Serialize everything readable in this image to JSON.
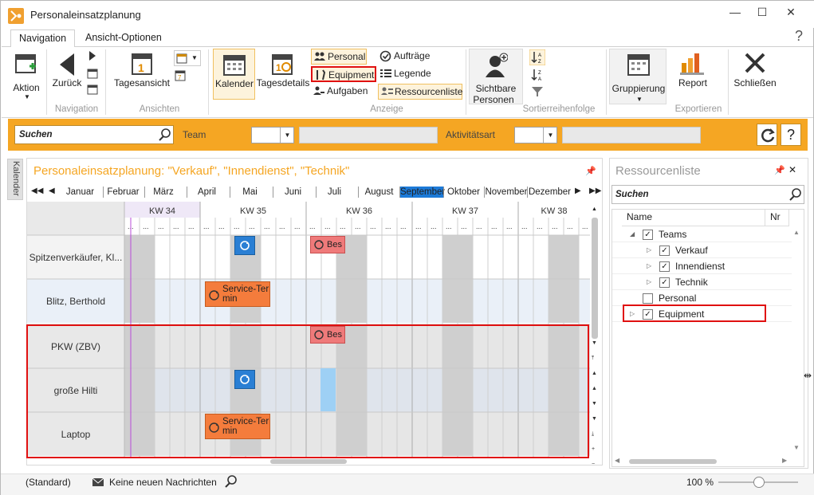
{
  "window": {
    "title": "Personaleinsatzplanung",
    "minimize": "—",
    "maximize": "☐",
    "close": "✕",
    "help": "?"
  },
  "tabs": [
    {
      "label": "Navigation"
    },
    {
      "label": "Ansicht-Optionen"
    }
  ],
  "ribbon": {
    "aktion": "Aktion",
    "zurueck": "Zurück",
    "tagesansicht": "Tagesansicht",
    "kalender": "Kalender",
    "tagesdetails": "Tagesdetails",
    "personal": "Personal",
    "equipment": "Equipment",
    "aufgaben": "Aufgaben",
    "auftraege": "Aufträge",
    "legende": "Legende",
    "ressourcenliste": "Ressourcenliste",
    "sichtbare_personen": "Sichtbare",
    "sichtbare_personen2": "Personen",
    "gruppierung": "Gruppierung",
    "report": "Report",
    "schliessen": "Schließen",
    "groups": {
      "navigation": "Navigation",
      "ansichten": "Ansichten",
      "anzeige": "Anzeige",
      "sortier": "Sortierreihenfolge",
      "exportieren": "Exportieren"
    }
  },
  "filter": {
    "search_placeholder": "Suchen",
    "team_label": "Team",
    "activity_label": "Aktivitätsart"
  },
  "sidebar_tab": "Kalender",
  "calendar": {
    "title": "Personaleinsatzplanung: \"Verkauf\", \"Innendienst\", \"Technik\"",
    "months": [
      "Januar",
      "Februar",
      "März",
      "April",
      "Mai",
      "Juni",
      "Juli",
      "August",
      "September",
      "Oktober",
      "November",
      "Dezember"
    ],
    "selected_month": "September",
    "weeks": [
      "KW 34",
      "KW 35",
      "KW 36",
      "KW 37",
      "KW 38"
    ],
    "rows": [
      {
        "label": "Spitzenverkäufer, Kl..."
      },
      {
        "label": "Blitz, Berthold"
      },
      {
        "label": "PKW (ZBV)"
      },
      {
        "label": "große Hilti"
      },
      {
        "label": "Laptop"
      }
    ],
    "events": {
      "bes": "Bes",
      "service": "Service-Ter min"
    }
  },
  "resource_list": {
    "title": "Ressourcenliste",
    "search_placeholder": "Suchen",
    "col_name": "Name",
    "col_nr": "Nr",
    "items": [
      {
        "label": "Teams",
        "checked": true
      },
      {
        "label": "Verkauf",
        "checked": true
      },
      {
        "label": "Innendienst",
        "checked": true
      },
      {
        "label": "Technik",
        "checked": true
      },
      {
        "label": "Personal",
        "checked": false
      },
      {
        "label": "Equipment",
        "checked": true
      }
    ]
  },
  "status": {
    "profile": "(Standard)",
    "messages": "Keine neuen Nachrichten",
    "zoom": "100 %"
  },
  "colors": {
    "accent_orange": "#f5a623",
    "highlight_red": "#e01010",
    "selected_blue": "#1c7ad8"
  }
}
